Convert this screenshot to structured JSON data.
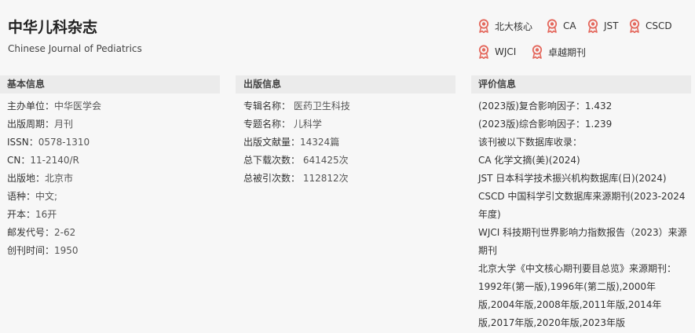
{
  "journal": {
    "title": "中华儿科杂志",
    "subtitle": "Chinese Journal of Pediatrics"
  },
  "badges": [
    {
      "label": "北大核心",
      "icon": "award-ribbon-icon"
    },
    {
      "label": "CA",
      "icon": "award-ribbon-icon"
    },
    {
      "label": "JST",
      "icon": "award-ribbon-icon"
    },
    {
      "label": "CSCD",
      "icon": "award-ribbon-icon"
    },
    {
      "label": "WJCI",
      "icon": "award-ribbon-icon"
    },
    {
      "label": "卓越期刊",
      "icon": "award-ribbon-icon"
    }
  ],
  "basic": {
    "heading": "基本信息",
    "rows": [
      {
        "label": "主办单位：",
        "value": "中华医学会"
      },
      {
        "label": "出版周期：",
        "value": "月刊"
      },
      {
        "label": "ISSN：",
        "value": "0578-1310"
      },
      {
        "label": "CN：",
        "value": "11-2140/R"
      },
      {
        "label": "出版地：",
        "value": "北京市"
      },
      {
        "label": "语种：",
        "value": "中文;"
      },
      {
        "label": "开本：",
        "value": "16开"
      },
      {
        "label": "邮发代号：",
        "value": "2-62"
      },
      {
        "label": "创刊时间：",
        "value": "1950"
      }
    ]
  },
  "publish": {
    "heading": "出版信息",
    "rows": [
      {
        "label": "专辑名称：",
        "value": "医药卫生科技"
      },
      {
        "label": "专题名称：",
        "value": "儿科学"
      },
      {
        "label": "出版文献量：",
        "value": "14324篇"
      },
      {
        "label": "总下载次数：",
        "value": "641425次"
      },
      {
        "label": "总被引次数：",
        "value": "112812次"
      }
    ]
  },
  "evaluation": {
    "heading": "评价信息",
    "rows": [
      "(2023版)复合影响因子：1.432",
      "(2023版)综合影响因子：1.239",
      "该刊被以下数据库收录：",
      "CA 化学文摘(美)(2024)",
      "JST 日本科学技术振兴机构数据库(日)(2024)",
      "CSCD 中国科学引文数据库来源期刊(2023-2024年度)",
      "WJCI 科技期刊世界影响力指数报告（2023）来源期刊",
      "北京大学《中文核心期刊要目总览》来源期刊：",
      "1992年(第一版),1996年(第二版),2000年版,2004年版,2008年版,2011年版,2014年版,2017年版,2020年版,2023年版"
    ]
  },
  "colors": {
    "badge_icon": "#e4685d",
    "section_bg": "#ebebeb",
    "page_bg": "#f7f7f7"
  }
}
